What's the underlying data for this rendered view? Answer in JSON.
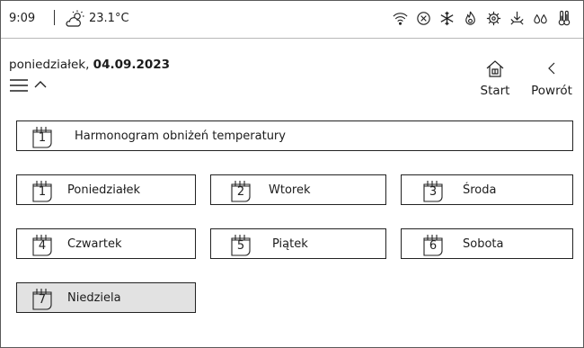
{
  "status_bar": {
    "time": "9:09",
    "temperature": "23.1°C",
    "icons": [
      "wifi-icon",
      "error-icon",
      "snowflake-icon",
      "flame-icon",
      "gear-warning-icon",
      "valve-icon",
      "water-drops-icon",
      "thermometer-icon"
    ]
  },
  "header": {
    "day": "poniedziałek,",
    "date": "04.09.2023",
    "start_label": "Start",
    "back_label": "Powrót"
  },
  "schedule": {
    "number": "1",
    "label": "Harmonogram  obniżeń temperatury"
  },
  "days": [
    {
      "number": "1",
      "label": "Poniedziałek"
    },
    {
      "number": "2",
      "label": "Wtorek"
    },
    {
      "number": "3",
      "label": "Środa"
    },
    {
      "number": "4",
      "label": "Czwartek"
    },
    {
      "number": "5",
      "label": "Piątek"
    },
    {
      "number": "6",
      "label": "Sobota"
    },
    {
      "number": "7",
      "label": "Niedziela"
    }
  ],
  "colors": {
    "selected_tile": "#e2e2e2",
    "border": "#222222"
  }
}
